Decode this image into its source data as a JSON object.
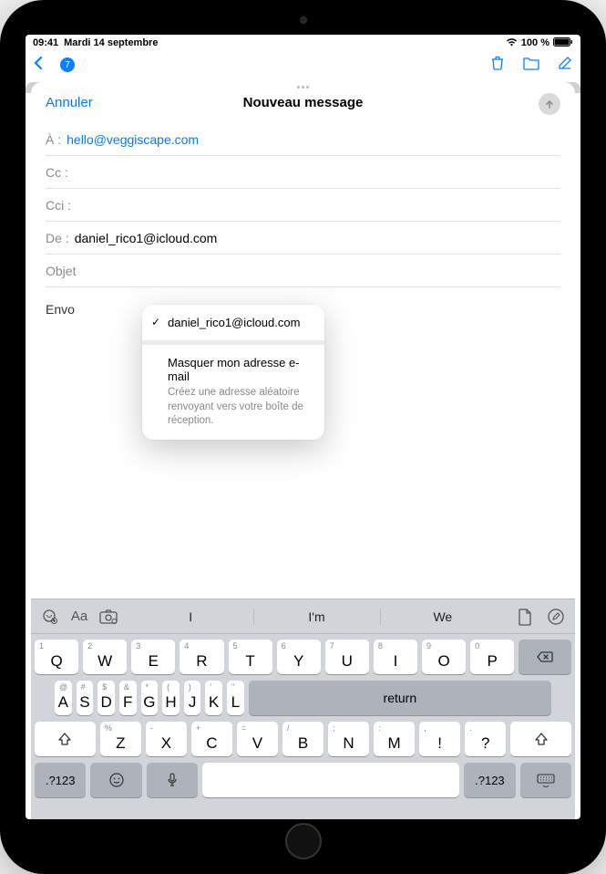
{
  "statusbar": {
    "time": "09:41",
    "date": "Mardi 14 septembre",
    "battery": "100 %"
  },
  "compose": {
    "cancel": "Annuler",
    "title": "Nouveau message",
    "to_label": "À :",
    "to_value": "hello@veggiscape.com",
    "cc_label": "Cc :",
    "cc_value": "",
    "bcc_label": "Cci :",
    "bcc_value": "",
    "from_label": "De :",
    "from_value": "daniel_rico1@icloud.com",
    "subject_label": "Objet",
    "body_preview": "Envo"
  },
  "popover": {
    "selected": "daniel_rico1@icloud.com",
    "hide_title": "Masquer mon adresse e-mail",
    "hide_sub": "Créez une adresse aléatoire renvoyant vers votre boîte de réception."
  },
  "keyboard": {
    "suggestions": [
      "I",
      "I'm",
      "We"
    ],
    "row1": [
      {
        "main": "Q",
        "alt": "1"
      },
      {
        "main": "W",
        "alt": "2"
      },
      {
        "main": "E",
        "alt": "3"
      },
      {
        "main": "R",
        "alt": "4"
      },
      {
        "main": "T",
        "alt": "5"
      },
      {
        "main": "Y",
        "alt": "6"
      },
      {
        "main": "U",
        "alt": "7"
      },
      {
        "main": "I",
        "alt": "8"
      },
      {
        "main": "O",
        "alt": "9"
      },
      {
        "main": "P",
        "alt": "0"
      }
    ],
    "row2": [
      {
        "main": "A",
        "alt": "@"
      },
      {
        "main": "S",
        "alt": "#"
      },
      {
        "main": "D",
        "alt": "$"
      },
      {
        "main": "F",
        "alt": "&"
      },
      {
        "main": "G",
        "alt": "*"
      },
      {
        "main": "H",
        "alt": "("
      },
      {
        "main": "J",
        "alt": ")"
      },
      {
        "main": "K",
        "alt": "'"
      },
      {
        "main": "L",
        "alt": "\""
      }
    ],
    "row3": [
      {
        "main": "Z",
        "alt": "%"
      },
      {
        "main": "X",
        "alt": "-"
      },
      {
        "main": "C",
        "alt": "+"
      },
      {
        "main": "V",
        "alt": "="
      },
      {
        "main": "B",
        "alt": "/"
      },
      {
        "main": "N",
        "alt": ";"
      },
      {
        "main": "M",
        "alt": ":"
      },
      {
        "main": "!",
        "alt": ","
      },
      {
        "main": "?",
        "alt": "."
      }
    ],
    "numkey": ".?123",
    "return": "return"
  }
}
